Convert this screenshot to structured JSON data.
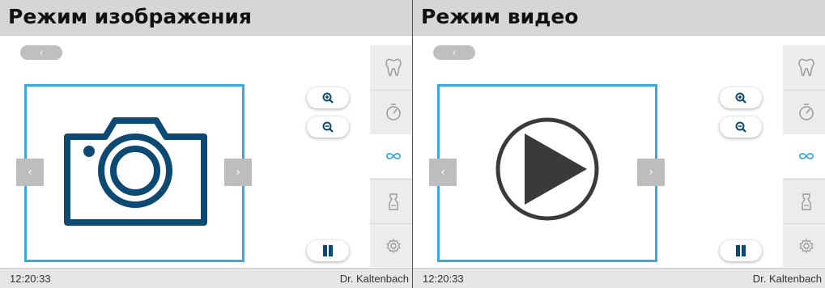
{
  "left_panel": {
    "title": "Режим изображения",
    "back_label": "‹",
    "prev_label": "‹",
    "next_label": "›",
    "media_icon": "camera-icon",
    "footer": {
      "time": "12:20:33",
      "user": "Dr. Kaltenbach"
    }
  },
  "right_panel": {
    "title": "Режим видео",
    "back_label": "‹",
    "prev_label": "‹",
    "next_label": "›",
    "media_icon": "play-icon",
    "footer": {
      "time": "12:20:33",
      "user": "Dr. Kaltenbach"
    }
  },
  "sidebar_items": [
    "tooth-icon",
    "timer-icon",
    "infinity-icon",
    "spray-bottle-icon",
    "gear-icon"
  ],
  "sidebar_active": "infinity-icon",
  "controls": [
    "zoom-in-icon",
    "zoom-out-icon",
    "pause-icon"
  ],
  "colors": {
    "accent": "#3ba7dc",
    "icon_dark": "#0d4a73",
    "sidebar_bg": "#ececec",
    "title_bg": "#d6d6d6"
  }
}
